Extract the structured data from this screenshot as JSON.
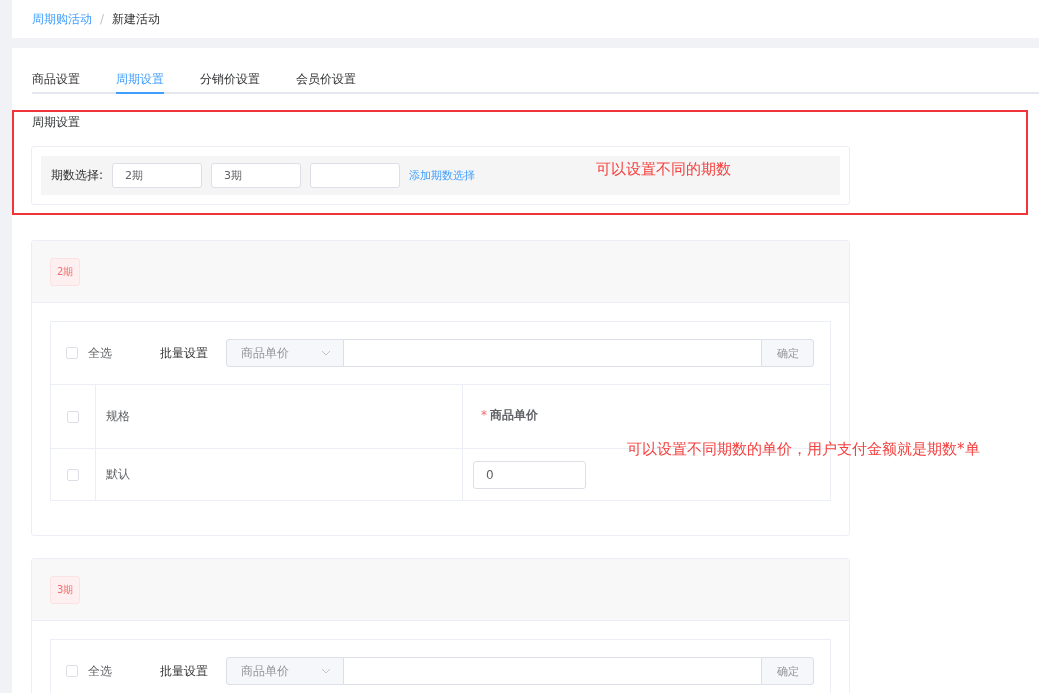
{
  "breadcrumb": [
    {
      "text": "周期购活动",
      "kind": "link"
    },
    {
      "text": "新建活动",
      "kind": "current"
    }
  ],
  "breadcrumb_separator": "/",
  "tabs": [
    {
      "label": "商品设置",
      "selected": false
    },
    {
      "label": "周期设置",
      "selected": true
    },
    {
      "label": "分销价设置",
      "selected": false
    },
    {
      "label": "会员价设置",
      "selected": false
    }
  ],
  "period_settings": {
    "title": "周期设置",
    "label": "期数选择:",
    "inputs": [
      {
        "kind": "filled",
        "value": "2期"
      },
      {
        "kind": "filled",
        "value": "3期"
      },
      {
        "kind": "empty"
      }
    ],
    "add_link": "添加期数选择"
  },
  "period_cards": [
    {
      "tag": "2期",
      "select_all": {
        "label": "全选",
        "checked": false
      },
      "batch_label": "批量设置",
      "batch_select": "商品单价",
      "confirm": "确定",
      "table": {
        "header_checked": false,
        "columns": [
          {
            "label": "规格",
            "required": false
          },
          {
            "label": "商品单价",
            "required": true
          }
        ],
        "required_mark": "*",
        "rows": [
          {
            "spec": "默认",
            "price": "0",
            "checked": false
          }
        ]
      }
    },
    {
      "tag": "3期",
      "select_all": {
        "label": "全选",
        "checked": false
      },
      "batch_label": "批量设置",
      "batch_select": "商品单价",
      "confirm": "确定"
    }
  ],
  "annotations": [
    {
      "kind": "highlight-box"
    },
    {
      "kind": "note",
      "text": "可以设置不同的期数"
    },
    {
      "kind": "note",
      "text": "可以设置不同期数的单价，用户支付金额就是期数*单"
    }
  ]
}
